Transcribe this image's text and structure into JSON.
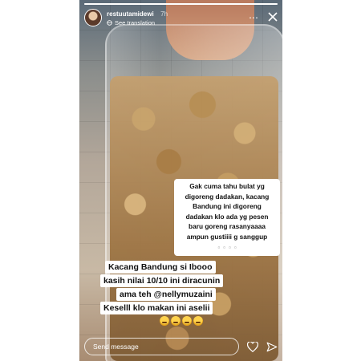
{
  "header": {
    "username": "restuutamidewi",
    "time": "7h",
    "translate_label": "See translation"
  },
  "progress": 1.0,
  "captions": {
    "top_lines": [
      "Gak cuma tahu bulat yg",
      "digoreng dadakan, kacang",
      "Bandung ini digoreng",
      "dadakan klo ada yg pesen",
      "baru goreng rasanyaaaa",
      "ampun gustiiii g sanggup"
    ],
    "bottom_lines": [
      "Kacang Bandung si Ibooo",
      "kasih nilai 10/10 ini diracunin",
      "ama teh @nellymuzaini",
      "Keselll klo makan ini aselii"
    ]
  },
  "footer": {
    "send_placeholder": "Send message"
  },
  "colors": {
    "overlay_text": "#ffffff",
    "caption_bg": "#ffffff",
    "caption_text": "#111111"
  }
}
